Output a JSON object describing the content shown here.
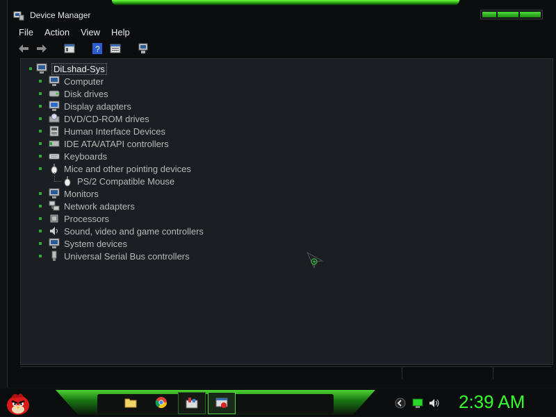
{
  "window": {
    "title": "Device Manager",
    "title_icon": "device-manager-icon"
  },
  "menu": [
    "File",
    "Action",
    "View",
    "Help"
  ],
  "toolbar": [
    "back-arrow-icon",
    "forward-arrow-icon",
    "properties-icon",
    "help-icon",
    "view-icon",
    "scan-hardware-icon"
  ],
  "tree": {
    "root": "DiLshad-Sys",
    "items": [
      {
        "label": "Computer",
        "icon": "computer-icon"
      },
      {
        "label": "Disk drives",
        "icon": "disk-drive-icon"
      },
      {
        "label": "Display adapters",
        "icon": "display-adapter-icon"
      },
      {
        "label": "DVD/CD-ROM drives",
        "icon": "dvd-drive-icon"
      },
      {
        "label": "Human Interface Devices",
        "icon": "hid-icon"
      },
      {
        "label": "IDE ATA/ATAPI controllers",
        "icon": "ide-controller-icon"
      },
      {
        "label": "Keyboards",
        "icon": "keyboard-icon"
      },
      {
        "label": "Mice and other pointing devices",
        "icon": "mouse-icon",
        "children": [
          {
            "label": "PS/2 Compatible Mouse",
            "icon": "mouse-icon"
          }
        ]
      },
      {
        "label": "Monitors",
        "icon": "monitor-icon"
      },
      {
        "label": "Network adapters",
        "icon": "network-adapter-icon"
      },
      {
        "label": "Processors",
        "icon": "processor-icon"
      },
      {
        "label": "Sound, video and game controllers",
        "icon": "speaker-icon"
      },
      {
        "label": "System devices",
        "icon": "system-device-icon"
      },
      {
        "label": "Universal Serial Bus controllers",
        "icon": "usb-icon"
      }
    ]
  },
  "taskbar": {
    "start_icon": "angry-bird-start-icon",
    "pinned": [
      "folder-icon",
      "chrome-icon",
      "control-panel-icon",
      "device-manager-icon"
    ],
    "tray": [
      "back-chevron-icon",
      "network-monitor-icon",
      "volume-icon"
    ],
    "clock": "2:39 AM"
  },
  "colors": {
    "accent_green": "#35ff2f",
    "background": "#1b1e22"
  }
}
